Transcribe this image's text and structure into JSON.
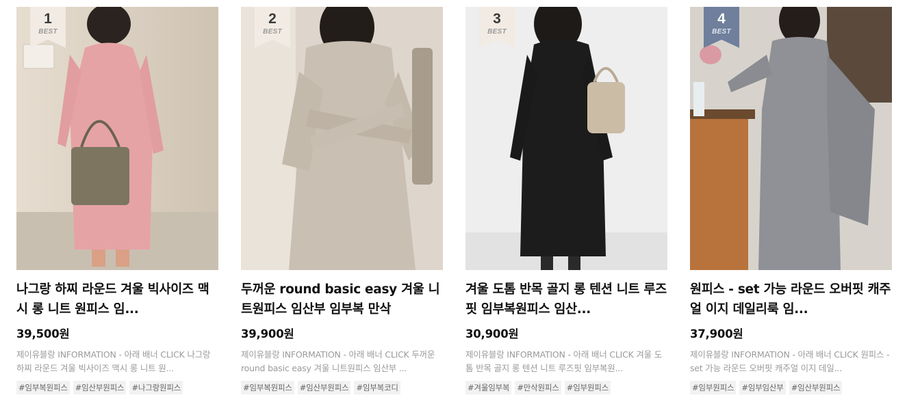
{
  "products": [
    {
      "rank": "1",
      "badge": "BEST",
      "title": "나그랑 하찌 라운드 겨울 빅사이즈 맥시 롱 니트 원피스 임...",
      "price": "39,500원",
      "description": "제이유블랑 INFORMATION - 아래 배너 CLICK 나그랑 하찌 라운드 겨울 빅사이즈 맥시 롱 니트 원...",
      "tags": [
        "#임부복원피스",
        "#임산부원피스",
        "#나그랑원피스"
      ],
      "badge_color": "#f1ebe3"
    },
    {
      "rank": "2",
      "badge": "BEST",
      "title": "두꺼운 round basic easy 겨울 니트원피스 임산부 임부복 만삭",
      "price": "39,900원",
      "description": "제이유블랑 INFORMATION - 아래 배너 CLICK 두꺼운 round basic easy 겨울 니트원피스 임산부 ...",
      "tags": [
        "#임부복원피스",
        "#임산부원피스",
        "#임부복코디"
      ],
      "badge_color": "#f1ebe3"
    },
    {
      "rank": "3",
      "badge": "BEST",
      "title": "겨울 도톰 반목 골지 롱 텐션 니트 루즈핏 임부복원피스 임산...",
      "price": "30,900원",
      "description": "제이유블랑 INFORMATION - 아래 배너 CLICK 겨울 도톰 반목 골지 롱 텐션 니트 루즈핏 임부복원...",
      "tags": [
        "#겨울임부복",
        "#만삭원피스",
        "#임부원피스"
      ],
      "badge_color": "#f1ebe3"
    },
    {
      "rank": "4",
      "badge": "BEST",
      "title": "원피스 - set 가능 라운드 오버핏 캐주얼 이지 데일리룩 임...",
      "price": "37,900원",
      "description": "제이유블랑 INFORMATION - 아래 배너 CLICK 원피스 - set 가능 라운드 오버핏 캐주얼 이지 데일...",
      "tags": [
        "#임부원피스",
        "#임부임산부",
        "#임산부원피스"
      ],
      "badge_color": "#6f7f9c"
    }
  ]
}
